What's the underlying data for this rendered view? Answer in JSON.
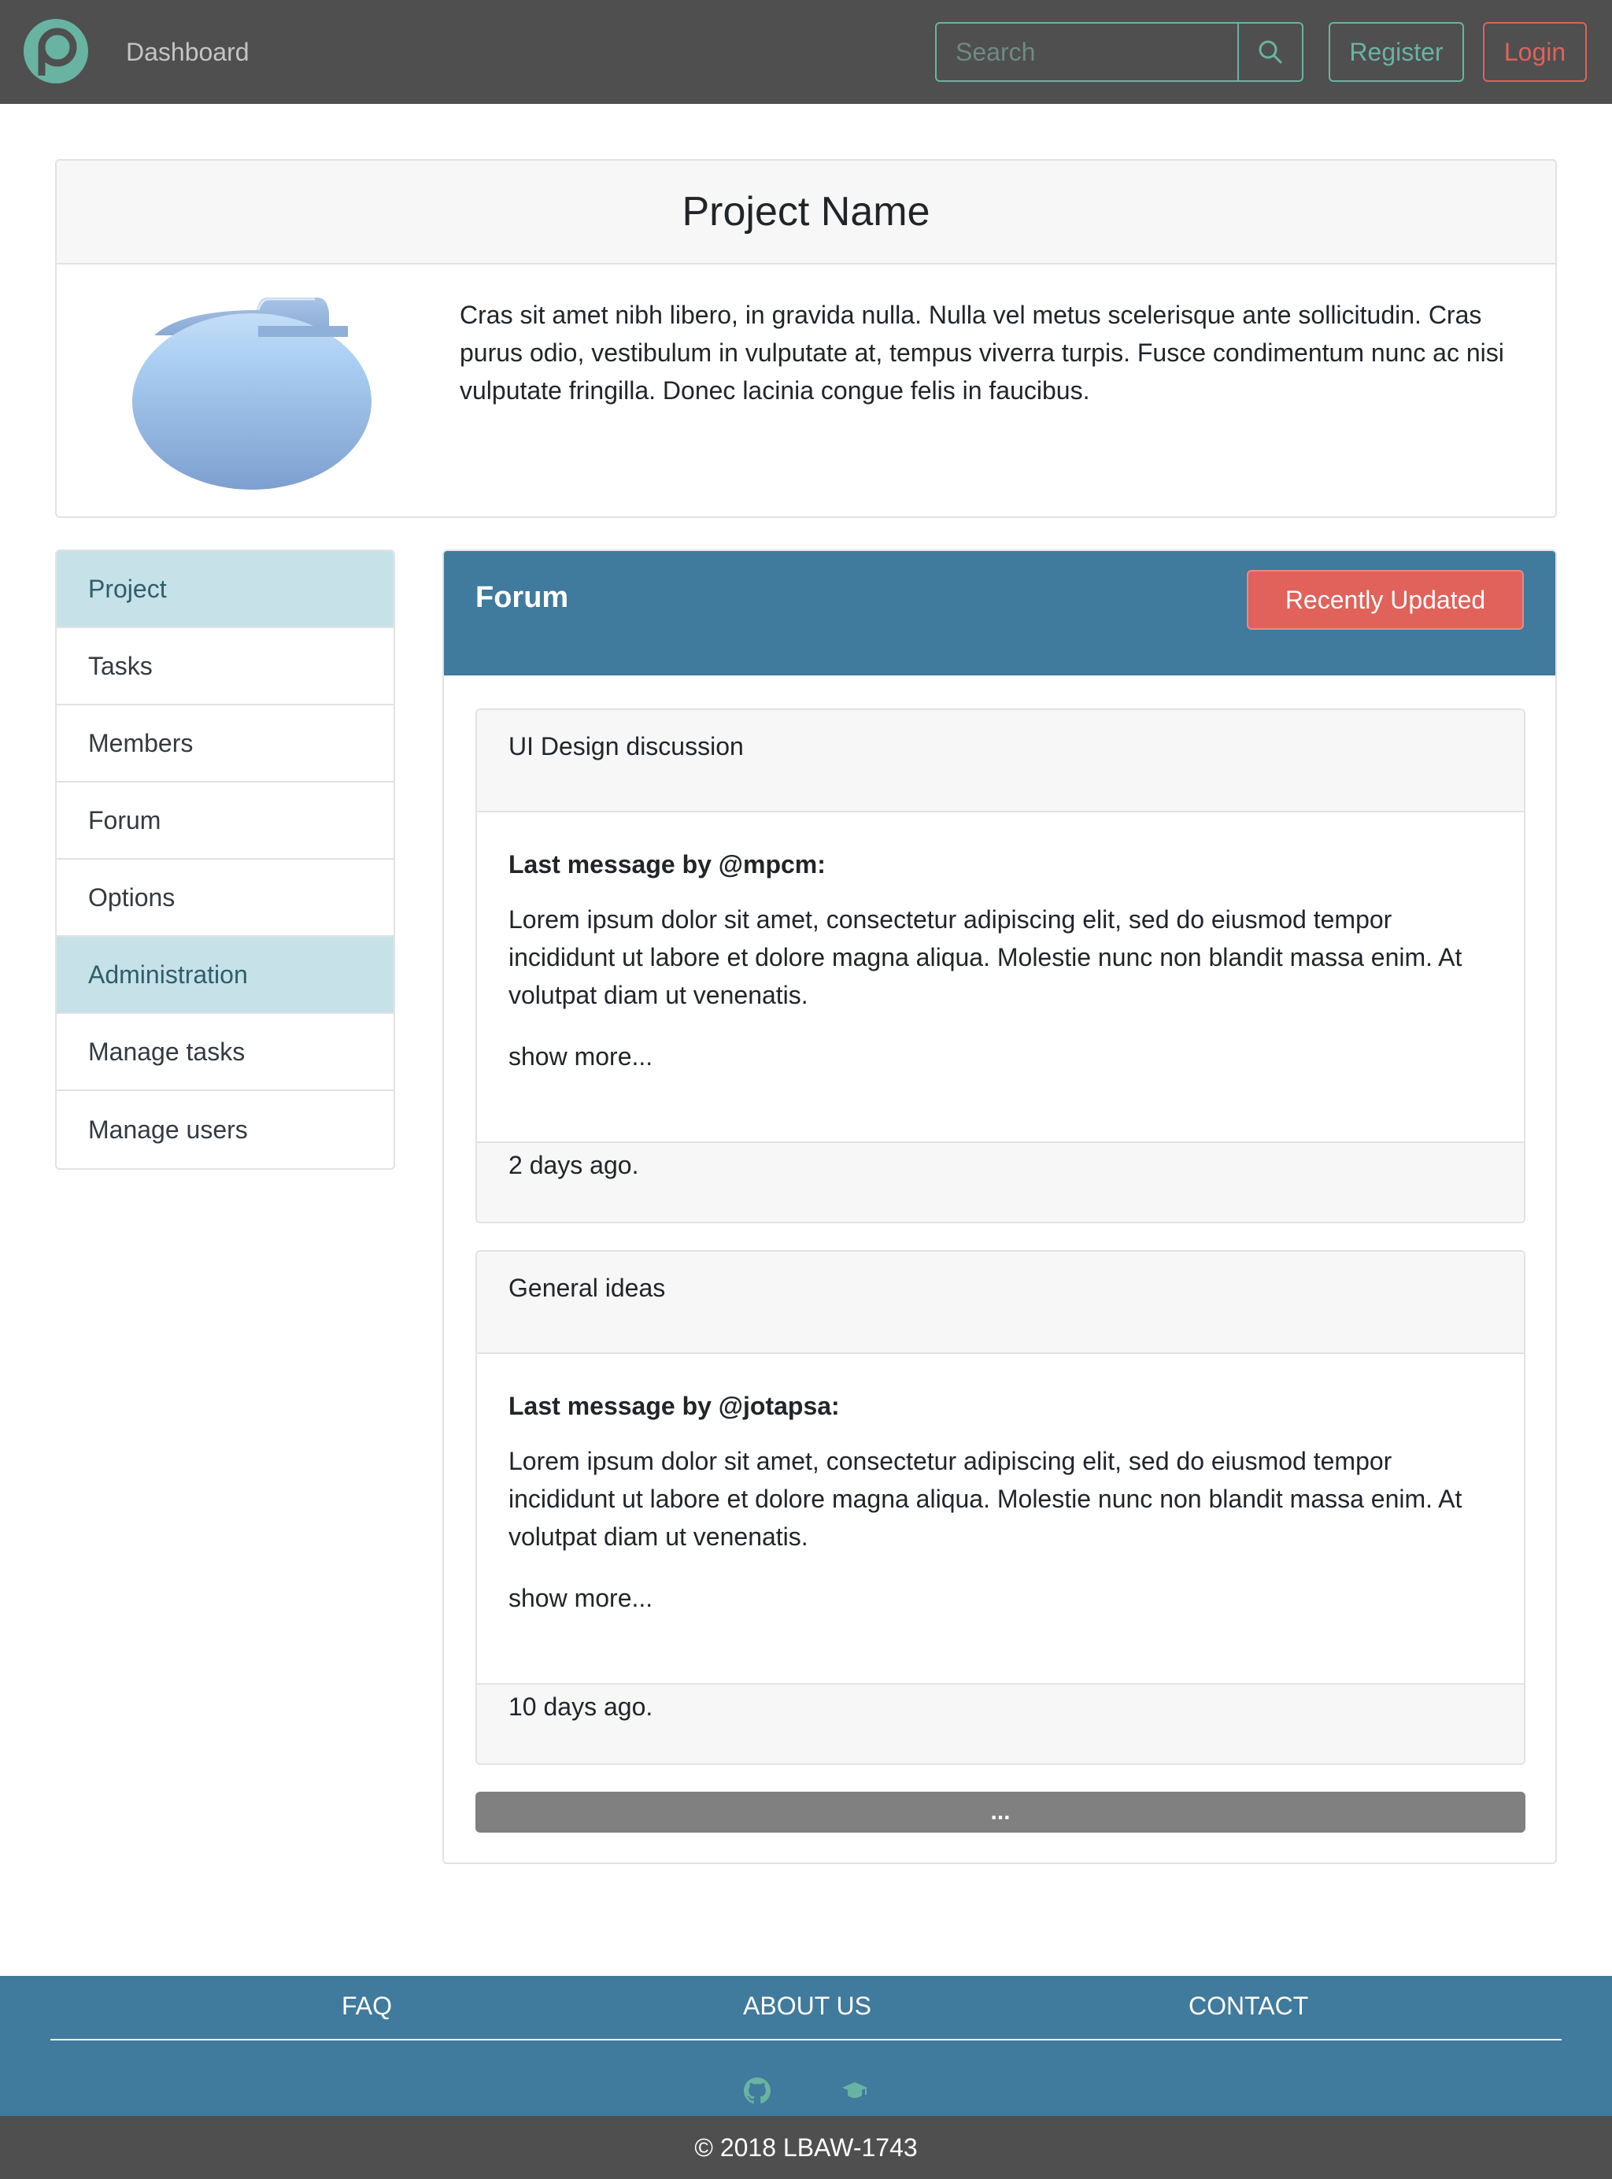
{
  "navbar": {
    "dashboard_label": "Dashboard",
    "search_placeholder": "Search",
    "search_icon": "search-icon",
    "register_label": "Register",
    "login_label": "Login",
    "accent_color": "#69b3a2",
    "login_color": "#e0625a"
  },
  "project": {
    "title": "Project Name",
    "description": "Cras sit amet nibh libero, in gravida nulla. Nulla vel metus scelerisque ante sollicitudin. Cras purus odio, vestibulum in vulputate at, tempus viverra turpis. Fusce condimentum nunc ac nisi vulputate fringilla. Donec lacinia congue felis in faucibus."
  },
  "sidebar": {
    "items": [
      {
        "label": "Project",
        "active": true
      },
      {
        "label": "Tasks",
        "active": false
      },
      {
        "label": "Members",
        "active": false
      },
      {
        "label": "Forum",
        "active": false
      },
      {
        "label": "Options",
        "active": false
      },
      {
        "label": "Administration",
        "active": true
      },
      {
        "label": "Manage tasks",
        "active": false
      },
      {
        "label": "Manage users",
        "active": false
      }
    ]
  },
  "forum": {
    "title": "Forum",
    "sort_button_label": "Recently Updated",
    "header_color": "#407a9c",
    "threads": [
      {
        "title": "UI Design discussion",
        "author_line": "Last message by @mpcm:",
        "message": "Lorem ipsum dolor sit amet, consectetur adipiscing elit, sed do eiusmod tempor incididunt ut labore et dolore magna aliqua. Molestie nunc non blandit massa enim. At volutpat diam ut venenatis.",
        "show_more": "show more...",
        "time": "2 days ago."
      },
      {
        "title": "General ideas",
        "author_line": "Last message by @jotapsa:",
        "message": "Lorem ipsum dolor sit amet, consectetur adipiscing elit, sed do eiusmod tempor incididunt ut labore et dolore magna aliqua. Molestie nunc non blandit massa enim. At volutpat diam ut venenatis.",
        "show_more": "show more...",
        "time": "10 days ago."
      }
    ],
    "more_label": "..."
  },
  "footer": {
    "links": [
      "FAQ",
      "ABOUT US",
      "CONTACT"
    ],
    "icons": [
      "github-icon",
      "graduation-cap-icon"
    ],
    "copyright": "© 2018 LBAW-1743"
  }
}
